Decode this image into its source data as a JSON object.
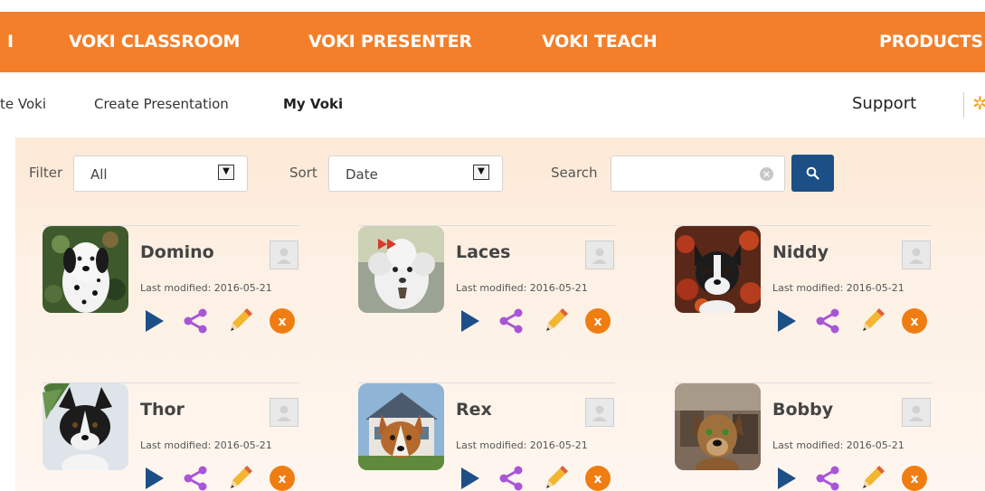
{
  "topnav": {
    "items": [
      "I",
      "VOKI CLASSROOM",
      "VOKI PRESENTER",
      "VOKI TEACH",
      "PRODUCTS"
    ],
    "bg_color": "#f47f2a"
  },
  "subnav": {
    "items": [
      "te Voki",
      "Create Presentation",
      "My Voki"
    ],
    "active": "My Voki",
    "support": "Support"
  },
  "filters": {
    "filter_label": "Filter",
    "filter_value": "All",
    "sort_label": "Sort",
    "sort_value": "Date",
    "search_label": "Search",
    "search_value": "",
    "search_placeholder": ""
  },
  "icons": {
    "search_button": "search-icon",
    "clear": "clear-icon",
    "play": "play-icon",
    "share": "share-icon",
    "edit": "pencil-icon",
    "delete": "delete-icon",
    "settings": "gear-icon"
  },
  "vokis": [
    {
      "name": "Domino",
      "last_modified": "Last modified: 2016-05-21"
    },
    {
      "name": "Laces",
      "last_modified": "Last modified: 2016-05-21"
    },
    {
      "name": "Niddy",
      "last_modified": "Last modified: 2016-05-21"
    },
    {
      "name": "Thor",
      "last_modified": "Last modified: 2016-05-21"
    },
    {
      "name": "Rex",
      "last_modified": "Last modified: 2016-05-21"
    },
    {
      "name": "Bobby",
      "last_modified": "Last modified: 2016-05-21"
    }
  ],
  "colors": {
    "play": "#1d4f87",
    "share": "#a855d8",
    "delete": "#f07d11",
    "search_button": "#1d4f87"
  }
}
